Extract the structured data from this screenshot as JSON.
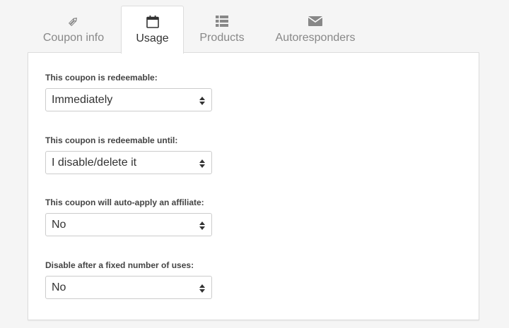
{
  "tabs": [
    {
      "label": "Coupon info",
      "icon": "tag-icon",
      "active": false
    },
    {
      "label": "Usage",
      "icon": "calendar-icon",
      "active": true
    },
    {
      "label": "Products",
      "icon": "list-icon",
      "active": false
    },
    {
      "label": "Autoresponders",
      "icon": "envelope-icon",
      "active": false
    }
  ],
  "fields": [
    {
      "label": "This coupon is redeemable:",
      "value": "Immediately"
    },
    {
      "label": "This coupon is redeemable until:",
      "value": "I disable/delete it"
    },
    {
      "label": "This coupon will auto-apply an affiliate:",
      "value": "No"
    },
    {
      "label": "Disable after a fixed number of uses:",
      "value": "No"
    }
  ]
}
